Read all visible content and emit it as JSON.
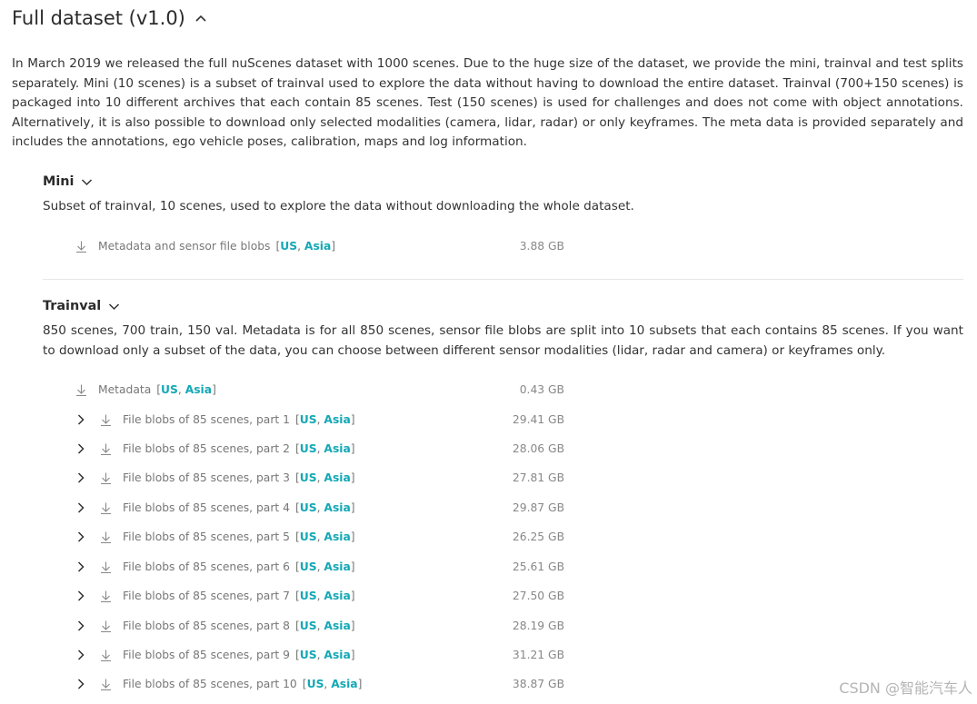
{
  "header": {
    "title": "Full dataset (v1.0)",
    "intro": "In March 2019 we released the full nuScenes dataset with 1000 scenes. Due to the huge size of the dataset, we provide the mini, trainval and test splits separately. Mini (10 scenes) is a subset of trainval used to explore the data without having to download the entire dataset. Trainval (700+150 scenes) is packaged into 10 different archives that each contain 85 scenes. Test (150 scenes) is used for challenges and does not come with object annotations. Alternatively, it is also possible to download only selected modalities (camera, lidar, radar) or only keyframes. The meta data is provided separately and includes the annotations, ego vehicle poses, calibration, maps and log information."
  },
  "mini": {
    "title": "Mini",
    "description": "Subset of trainval, 10 scenes, used to explore the data without downloading the whole dataset.",
    "rows": [
      {
        "label": "Metadata and sensor file blobs",
        "region_us": "US",
        "region_asia": "Asia",
        "size": "3.88 GB"
      }
    ]
  },
  "trainval": {
    "title": "Trainval",
    "description": "850 scenes, 700 train, 150 val. Metadata is for all 850 scenes, sensor file blobs are split into 10 subsets that each contains 85 scenes. If you want to download only a subset of the data, you can choose between different sensor modalities (lidar, radar and camera) or keyframes only.",
    "metadata": {
      "label": "Metadata",
      "region_us": "US",
      "region_asia": "Asia",
      "size": "0.43 GB"
    },
    "parts": [
      {
        "label": "File blobs of 85 scenes, part 1",
        "region_us": "US",
        "region_asia": "Asia",
        "size": "29.41 GB"
      },
      {
        "label": "File blobs of 85 scenes, part 2",
        "region_us": "US",
        "region_asia": "Asia",
        "size": "28.06 GB"
      },
      {
        "label": "File blobs of 85 scenes, part 3",
        "region_us": "US",
        "region_asia": "Asia",
        "size": "27.81 GB"
      },
      {
        "label": "File blobs of 85 scenes, part 4",
        "region_us": "US",
        "region_asia": "Asia",
        "size": "29.87 GB"
      },
      {
        "label": "File blobs of 85 scenes, part 5",
        "region_us": "US",
        "region_asia": "Asia",
        "size": "26.25 GB"
      },
      {
        "label": "File blobs of 85 scenes, part 6",
        "region_us": "US",
        "region_asia": "Asia",
        "size": "25.61 GB"
      },
      {
        "label": "File blobs of 85 scenes, part 7",
        "region_us": "US",
        "region_asia": "Asia",
        "size": "27.50 GB"
      },
      {
        "label": "File blobs of 85 scenes, part 8",
        "region_us": "US",
        "region_asia": "Asia",
        "size": "28.19 GB"
      },
      {
        "label": "File blobs of 85 scenes, part 9",
        "region_us": "US",
        "region_asia": "Asia",
        "size": "31.21 GB"
      },
      {
        "label": "File blobs of 85 scenes, part 10",
        "region_us": "US",
        "region_asia": "Asia",
        "size": "38.87 GB"
      }
    ]
  },
  "watermark": "CSDN @智能汽车人",
  "colors": {
    "link": "#13a8b5",
    "text": "#333333",
    "muted": "#777777"
  },
  "icons": {
    "collapse": "chevron-up-icon",
    "expand": "chevron-down-icon",
    "row_expand": "chevron-right-icon",
    "download": "download-icon"
  }
}
